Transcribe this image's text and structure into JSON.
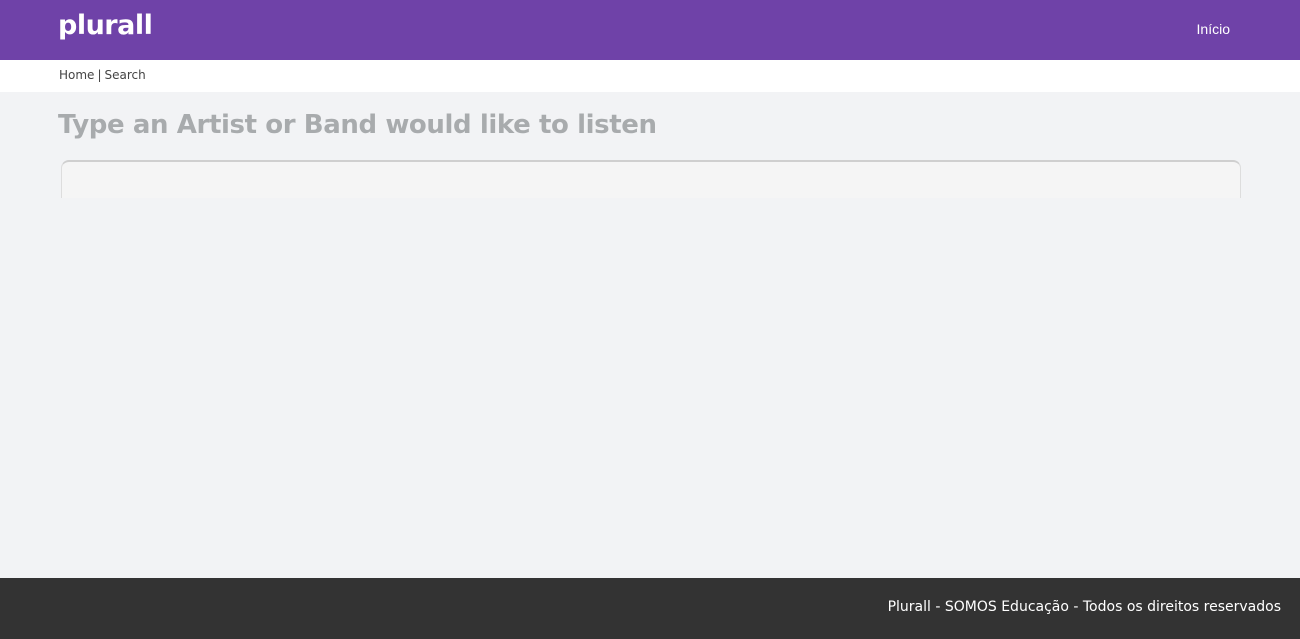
{
  "header": {
    "logo_text": "plurall",
    "nav_inicio": "Início",
    "background_color": "#6f42a8"
  },
  "breadcrumb": {
    "home": "Home",
    "separator": "|",
    "current": "Search"
  },
  "main": {
    "title": "Type an Artist or Band would like to listen",
    "search_value": "",
    "search_placeholder": ""
  },
  "footer": {
    "text": "Plurall - SOMOS Educação - Todos os direitos reservados",
    "background_color": "#333333"
  }
}
